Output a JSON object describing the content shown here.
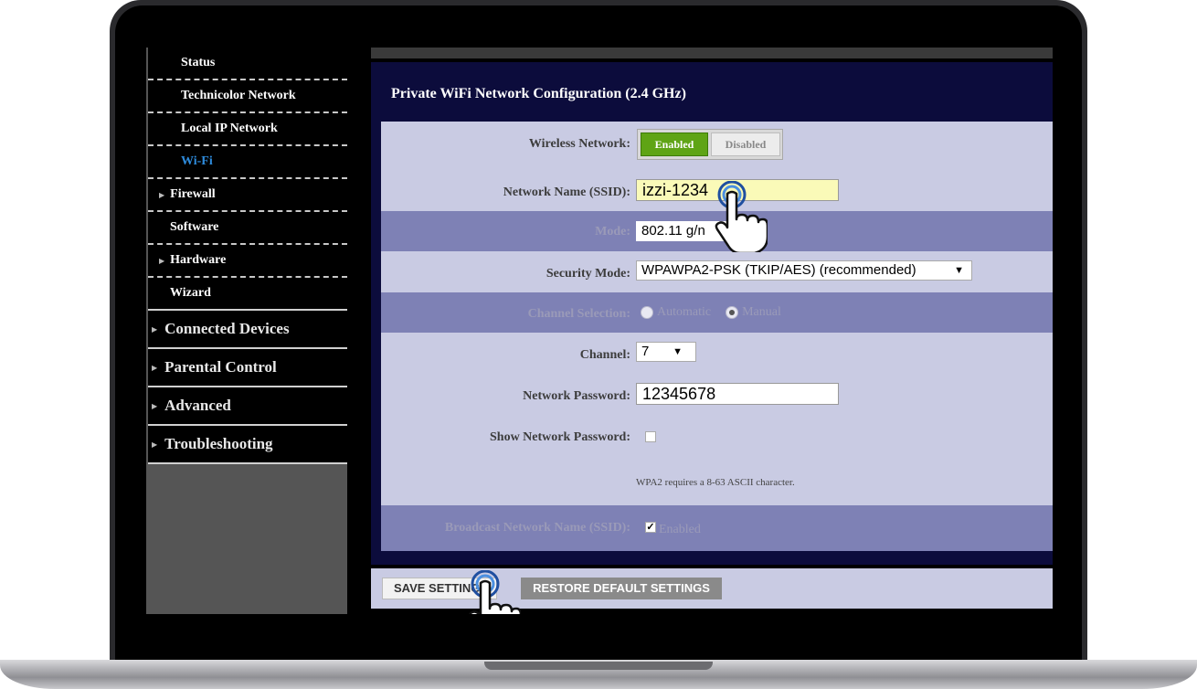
{
  "sidebar": {
    "sub_items": [
      {
        "label": "Status"
      },
      {
        "label": "Technicolor Network"
      },
      {
        "label": "Local IP Network"
      },
      {
        "label": "Wi-Fi"
      },
      {
        "label": "Firewall"
      },
      {
        "label": "Software"
      },
      {
        "label": "Hardware"
      },
      {
        "label": "Wizard"
      }
    ],
    "major_items": [
      {
        "label": "Connected Devices"
      },
      {
        "label": "Parental Control"
      },
      {
        "label": "Advanced"
      },
      {
        "label": "Troubleshooting"
      }
    ],
    "active_color": "#2e8bdc"
  },
  "panel": {
    "title": "Private WiFi Network Configuration (2.4 GHz)"
  },
  "form": {
    "wireless_network": {
      "label": "Wireless Network:",
      "enabled": "Enabled",
      "disabled": "Disabled"
    },
    "ssid": {
      "label": "Network Name (SSID):",
      "value": "izzi-1234"
    },
    "mode": {
      "label": "Mode:",
      "value": "802.11 g/n"
    },
    "security_mode": {
      "label": "Security Mode:",
      "value": "WPAWPA2-PSK (TKIP/AES) (recommended)"
    },
    "channel_selection": {
      "label": "Channel Selection:",
      "automatic": "Automatic",
      "manual": "Manual"
    },
    "channel": {
      "label": "Channel:",
      "value": "7"
    },
    "password": {
      "label": "Network Password:",
      "value": "12345678"
    },
    "show_password": {
      "label": "Show Network Password:"
    },
    "hint": "WPA2 requires a 8-63 ASCII character.",
    "broadcast": {
      "label": "Broadcast Network Name (SSID):",
      "checkbox_label": "Enabled"
    }
  },
  "buttons": {
    "save": "SAVE SETTINGS",
    "restore": "RESTORE DEFAULT SETTINGS"
  },
  "colors": {
    "panel_header": "#0c0c3c",
    "form_light": "#c9cbe3",
    "form_dark": "#7e81b5",
    "enabled_green": "#5fa415"
  }
}
